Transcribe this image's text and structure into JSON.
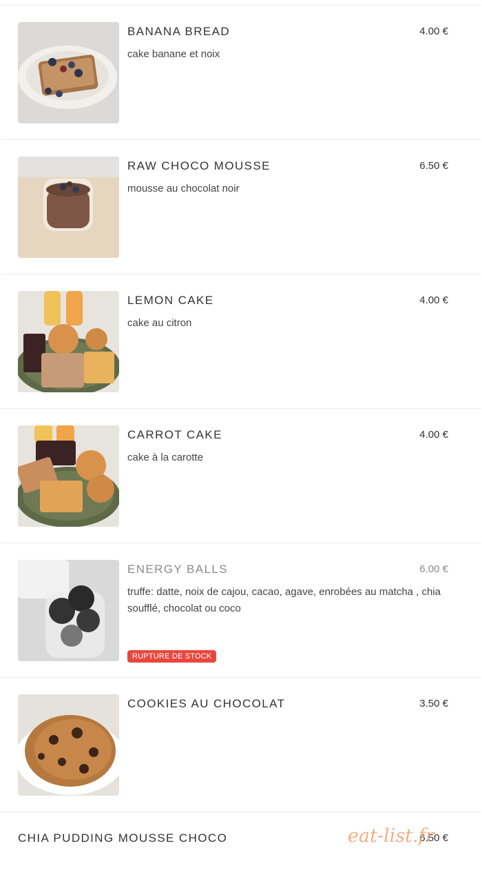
{
  "items": [
    {
      "name": "BANANA BREAD",
      "price": "4.00 €",
      "description": "cake banane et noix",
      "image": "banana-bread-photo"
    },
    {
      "name": "RAW CHOCO MOUSSE",
      "price": "6.50 €",
      "description": "mousse au chocolat noir",
      "image": "choco-mousse-photo"
    },
    {
      "name": "LEMON CAKE",
      "price": "4.00 €",
      "description": "cake au citron",
      "image": "lemon-cake-photo"
    },
    {
      "name": "CARROT CAKE",
      "price": "4.00 €",
      "description": "cake à la carotte",
      "image": "carrot-cake-photo"
    },
    {
      "name": "ENERGY BALLS",
      "price": "6.00 €",
      "description": "truffe: datte, noix de cajou, cacao, agave, enrobées au matcha , chia soufflé, chocolat ou coco",
      "badge": "RUPTURE DE STOCK",
      "badge_color": "#e8473f",
      "image": "energy-balls-photo"
    },
    {
      "name": "COOKIES AU CHOCOLAT",
      "price": "3.50 €",
      "description": "",
      "image": "cookie-photo"
    },
    {
      "name": "CHIA PUDDING MOUSSE CHOCO",
      "price": "6.50 €"
    }
  ],
  "watermark": "eat-list.fr"
}
